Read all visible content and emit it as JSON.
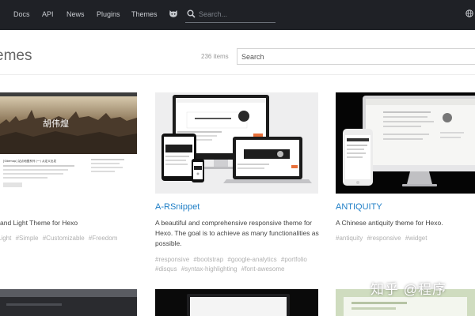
{
  "nav": {
    "links": [
      "Docs",
      "API",
      "News",
      "Plugins",
      "Themes"
    ],
    "search_placeholder": "Search..."
  },
  "page": {
    "title": "emes",
    "item_count": "236 items",
    "search_placeholder": "Search"
  },
  "thumb_text": {
    "card1_overlay": "胡伟煌",
    "card1_post": "[Sitemap] 站点地图系列 (一) 从定义出发"
  },
  "cards": [
    {
      "name": "",
      "description": "and Light Theme for Hexo",
      "tags": [
        "Light",
        "#Simple",
        "#Customizable",
        "#Freedom"
      ]
    },
    {
      "name": "A-RSnippet",
      "description": "A beautiful and comprehensive responsive theme for Hexo. The goal is to achieve as many functionalities as possible.",
      "tags": [
        "#responsive",
        "#bootstrap",
        "#google-analytics",
        "#portfolio",
        "#disqus",
        "#syntax-highlighting",
        "#font-awesome"
      ]
    },
    {
      "name": "ANTIQUITY",
      "description": "A Chinese antiquity theme for Hexo.",
      "tags": [
        "#antiquity",
        "#responsive",
        "#widget"
      ]
    }
  ],
  "watermark": "知乎 @程序",
  "colors": {
    "nav_bg": "#1f2126",
    "link": "#1e7ec6",
    "tag": "#b0b0b0"
  },
  "icons": [
    "hexo-cat-icon",
    "search-icon",
    "globe-icon"
  ]
}
